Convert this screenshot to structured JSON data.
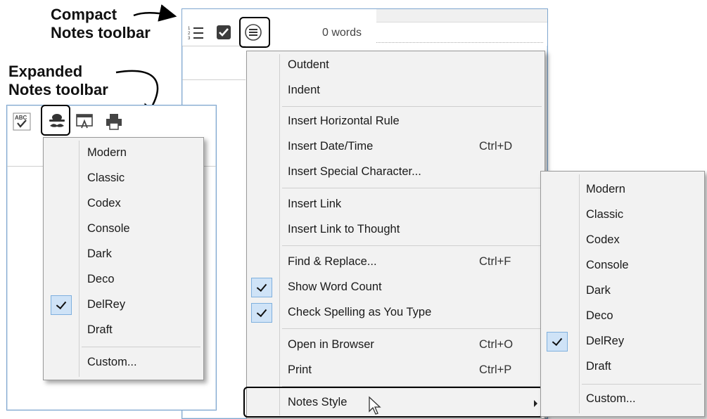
{
  "callouts": {
    "compact": [
      "Compact",
      "Notes toolbar"
    ],
    "expanded": [
      "Expanded",
      "Notes toolbar"
    ]
  },
  "compact_toolbar": {
    "word_count": "0 words",
    "icons": [
      "numbered-list-icon",
      "checkbox-icon",
      "hamburger-menu-icon"
    ]
  },
  "expanded_toolbar": {
    "icons": [
      "spell-check-icon",
      "style-icon",
      "open-in-browser-icon",
      "print-icon"
    ]
  },
  "main_menu": {
    "items": [
      {
        "label": "Outdent",
        "shortcut": ""
      },
      {
        "label": "Indent",
        "shortcut": ""
      },
      {
        "label": "Insert Horizontal Rule",
        "shortcut": ""
      },
      {
        "label": "Insert Date/Time",
        "shortcut": "Ctrl+D"
      },
      {
        "label": "Insert Special Character...",
        "shortcut": ""
      },
      {
        "label": "Insert Link",
        "shortcut": ""
      },
      {
        "label": "Insert Link to Thought",
        "shortcut": ""
      },
      {
        "label": "Find & Replace...",
        "shortcut": "Ctrl+F"
      },
      {
        "label": "Show Word Count",
        "shortcut": "",
        "checked": true
      },
      {
        "label": "Check Spelling as You Type",
        "shortcut": "",
        "checked": true
      },
      {
        "label": "Open in Browser",
        "shortcut": "Ctrl+O"
      },
      {
        "label": "Print",
        "shortcut": "Ctrl+P"
      },
      {
        "label": "Notes Style",
        "shortcut": "",
        "submenu": true
      }
    ]
  },
  "style_menu_left": {
    "items": [
      "Modern",
      "Classic",
      "Codex",
      "Console",
      "Dark",
      "Deco",
      "DelRey",
      "Draft",
      "Custom..."
    ],
    "selected": "DelRey"
  },
  "style_menu_right": {
    "items": [
      "Modern",
      "Classic",
      "Codex",
      "Console",
      "Dark",
      "Deco",
      "DelRey",
      "Draft",
      "Custom..."
    ],
    "selected": "DelRey"
  },
  "colors": {
    "window_border": "#7ea6cf",
    "menu_bg": "#f2f2f2",
    "check_bg": "#cfe3f7"
  }
}
